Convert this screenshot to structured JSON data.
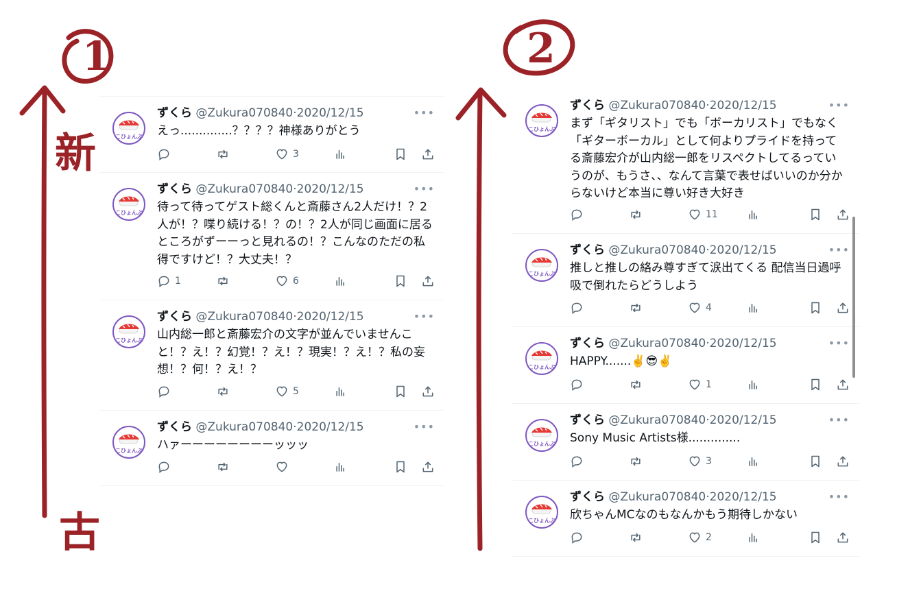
{
  "annotations": {
    "label1": "①",
    "label2": "②",
    "new_label": "新",
    "old_label": "古"
  },
  "columns": [
    {
      "tweets": [
        {
          "name": "ずくら",
          "handle": "@Zukura070840",
          "date": "2020/12/15",
          "text": "えっ..............？？？？神様ありがとう",
          "replies": "",
          "likes": "3"
        },
        {
          "name": "ずくら",
          "handle": "@Zukura070840",
          "date": "2020/12/15",
          "text": "待って待ってゲスト総くんと斎藤さん2人だけ！？2人が！？喋り続ける！？の！？2人が同じ画面に居るところがずーーっと見れるの！？こんなのただの私得ですけど！？大丈夫！？",
          "replies": "1",
          "likes": "6"
        },
        {
          "name": "ずくら",
          "handle": "@Zukura070840",
          "date": "2020/12/15",
          "text": "山内総一郎と斎藤宏介の文字が並んでいませんこと！？え！？幻覚！？え！？現実！？え！？私の妄想！？何！？え！？",
          "replies": "",
          "likes": "5"
        },
        {
          "name": "ずくら",
          "handle": "@Zukura070840",
          "date": "2020/12/15",
          "text": "ハァーーーーーーーーッッッ",
          "replies": "",
          "likes": ""
        }
      ]
    },
    {
      "tweets": [
        {
          "name": "ずくら",
          "handle": "@Zukura070840",
          "date": "2020/12/15",
          "text": "まず「ギタリスト」でも「ボーカリスト」でもなく「ギターボーカル」として何よりプライドを持ってる斎藤宏介が山内総一郎をリスペクトしてるっていうのが、もうさ、、なんて言葉で表せばいいのか分からないけど本当に尊い好き大好き",
          "replies": "",
          "likes": "11"
        },
        {
          "name": "ずくら",
          "handle": "@Zukura070840",
          "date": "2020/12/15",
          "text": "推しと推しの絡み尊すぎて涙出てくる 配信当日過呼吸で倒れたらどうしよう",
          "replies": "",
          "likes": "4"
        },
        {
          "name": "ずくら",
          "handle": "@Zukura070840",
          "date": "2020/12/15",
          "text": "HAPPY.......✌️😎✌️",
          "replies": "",
          "likes": "1"
        },
        {
          "name": "ずくら",
          "handle": "@Zukura070840",
          "date": "2020/12/15",
          "text": "Sony Music Artists様..............",
          "replies": "",
          "likes": "3"
        },
        {
          "name": "ずくら",
          "handle": "@Zukura070840",
          "date": "2020/12/15",
          "text": "欣ちゃんMCなのもなんかもう期待しかない",
          "replies": "",
          "likes": "2"
        }
      ]
    }
  ],
  "colors": {
    "annotation": "#9b2226",
    "muted": "#536471",
    "avatar_ring": "#7e57c2"
  }
}
